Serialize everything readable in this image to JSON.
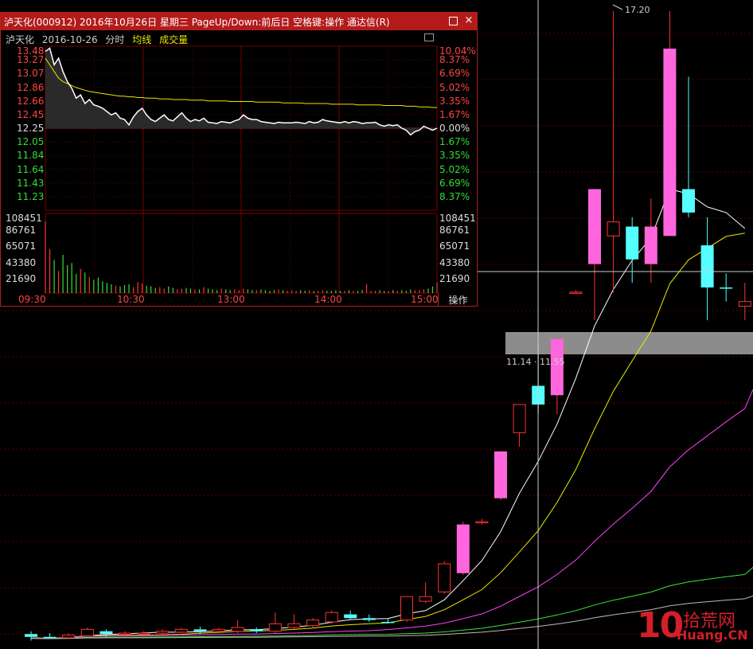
{
  "window": {
    "title": "泸天化(000912) 2016年10月26日 星期三 PageUp/Down:前后日 空格键:操作 通达信(R)",
    "close_glyph": "×"
  },
  "subheader": {
    "name": "泸天化",
    "date": "2016-10-26",
    "mode": "分时",
    "avg_label": "均线",
    "vol_label": "成交量"
  },
  "intraday": {
    "price_axis_left": [
      "13.48",
      "13.27",
      "13.07",
      "12.86",
      "12.66",
      "12.45",
      "12.25",
      "12.05",
      "11.84",
      "11.64",
      "11.43",
      "11.23"
    ],
    "pct_axis_right": [
      "10.04%",
      "8.37%",
      "6.69%",
      "5.02%",
      "3.35%",
      "1.67%",
      "0.00%",
      "1.67%",
      "3.35%",
      "5.02%",
      "6.69%",
      "8.37%"
    ],
    "vol_axis_left": [
      "108451",
      "86761",
      "65071",
      "43380",
      "21690"
    ],
    "vol_axis_right": [
      "108451",
      "86761",
      "65071",
      "43380",
      "21690"
    ],
    "time_labels": [
      "09:30",
      "10:30",
      "13:00",
      "14:00",
      "15:00"
    ],
    "operate_button": "操作",
    "prev_close": 12.25,
    "price_series": [
      13.4,
      13.45,
      13.2,
      13.3,
      13.1,
      12.95,
      12.85,
      12.7,
      12.75,
      12.62,
      12.68,
      12.6,
      12.58,
      12.55,
      12.5,
      12.45,
      12.48,
      12.4,
      12.38,
      12.3,
      12.42,
      12.5,
      12.55,
      12.45,
      12.38,
      12.35,
      12.4,
      12.45,
      12.38,
      12.36,
      12.42,
      12.48,
      12.4,
      12.35,
      12.38,
      12.36,
      12.4,
      12.34,
      12.33,
      12.32,
      12.35,
      12.34,
      12.33,
      12.36,
      12.38,
      12.45,
      12.4,
      12.38,
      12.38,
      12.35,
      12.34,
      12.33,
      12.32,
      12.34,
      12.33,
      12.33,
      12.33,
      12.34,
      12.33,
      12.32,
      12.35,
      12.33,
      12.34,
      12.38,
      12.36,
      12.35,
      12.34,
      12.33,
      12.35,
      12.33,
      12.35,
      12.34,
      12.32,
      12.33,
      12.33,
      12.34,
      12.3,
      12.28,
      12.3,
      12.29,
      12.3,
      12.25,
      12.22,
      12.15,
      12.2,
      12.22,
      12.28,
      12.25,
      12.22,
      12.25
    ],
    "avg_series": [
      13.3,
      13.2,
      13.1,
      13.0,
      12.95,
      12.92,
      12.89,
      12.86,
      12.84,
      12.82,
      12.8,
      12.79,
      12.78,
      12.77,
      12.76,
      12.75,
      12.74,
      12.73,
      12.73,
      12.72,
      12.72,
      12.71,
      12.71,
      12.7,
      12.7,
      12.7,
      12.69,
      12.69,
      12.69,
      12.68,
      12.68,
      12.68,
      12.68,
      12.67,
      12.67,
      12.67,
      12.67,
      12.66,
      12.66,
      12.66,
      12.66,
      12.66,
      12.65,
      12.65,
      12.65,
      12.65,
      12.65,
      12.65,
      12.64,
      12.64,
      12.64,
      12.64,
      12.64,
      12.64,
      12.63,
      12.63,
      12.63,
      12.63,
      12.63,
      12.62,
      12.62,
      12.62,
      12.62,
      12.62,
      12.62,
      12.61,
      12.61,
      12.61,
      12.61,
      12.61,
      12.61,
      12.6,
      12.6,
      12.6,
      12.6,
      12.6,
      12.6,
      12.59,
      12.59,
      12.59,
      12.59,
      12.59,
      12.58,
      12.58,
      12.58,
      12.57,
      12.57,
      12.57,
      12.56,
      12.56
    ],
    "volume_series": [
      98000,
      60000,
      45000,
      30000,
      52000,
      38000,
      41000,
      26000,
      33000,
      28000,
      22000,
      18000,
      21000,
      16000,
      14000,
      12000,
      10000,
      9000,
      11000,
      12000,
      8000,
      15000,
      13000,
      10000,
      9000,
      7000,
      8000,
      6000,
      9000,
      7000,
      5000,
      6000,
      7000,
      6000,
      5000,
      5000,
      8000,
      6000,
      5000,
      4000,
      6000,
      5000,
      4000,
      5000,
      4000,
      6000,
      5000,
      4000,
      4000,
      5000,
      4000,
      3000,
      4000,
      5000,
      4000,
      3000,
      4000,
      3000,
      4000,
      3000,
      4000,
      3000,
      3000,
      4000,
      3000,
      3000,
      4000,
      3000,
      3000,
      4000,
      3000,
      3000,
      4000,
      12000,
      3000,
      3000,
      4000,
      3000,
      3000,
      4000,
      3000,
      4000,
      3000,
      5000,
      4000,
      4000,
      5000,
      6000,
      9000,
      14000
    ]
  },
  "kline": {
    "price_label_top": "17.20",
    "crosshair_tip": "11.14 · 11.55",
    "candles": [
      {
        "o": 10.55,
        "h": 10.58,
        "l": 10.48,
        "c": 10.52,
        "up": false
      },
      {
        "o": 10.52,
        "h": 10.56,
        "l": 10.5,
        "c": 10.51,
        "up": false
      },
      {
        "o": 10.51,
        "h": 10.56,
        "l": 10.5,
        "c": 10.54,
        "up": true
      },
      {
        "o": 10.53,
        "h": 10.62,
        "l": 10.52,
        "c": 10.6,
        "up": true
      },
      {
        "o": 10.58,
        "h": 10.6,
        "l": 10.52,
        "c": 10.55,
        "up": false
      },
      {
        "o": 10.55,
        "h": 10.58,
        "l": 10.52,
        "c": 10.56,
        "up": true
      },
      {
        "o": 10.56,
        "h": 10.58,
        "l": 10.54,
        "c": 10.56,
        "up": true
      },
      {
        "o": 10.56,
        "h": 10.6,
        "l": 10.54,
        "c": 10.58,
        "up": true
      },
      {
        "o": 10.57,
        "h": 10.62,
        "l": 10.56,
        "c": 10.6,
        "up": true
      },
      {
        "o": 10.6,
        "h": 10.63,
        "l": 10.55,
        "c": 10.58,
        "up": false
      },
      {
        "o": 10.58,
        "h": 10.62,
        "l": 10.56,
        "c": 10.6,
        "up": true
      },
      {
        "o": 10.58,
        "h": 10.7,
        "l": 10.56,
        "c": 10.62,
        "up": true
      },
      {
        "o": 10.6,
        "h": 10.62,
        "l": 10.56,
        "c": 10.58,
        "up": false
      },
      {
        "o": 10.58,
        "h": 10.78,
        "l": 10.56,
        "c": 10.66,
        "up": true
      },
      {
        "o": 10.62,
        "h": 10.76,
        "l": 10.6,
        "c": 10.66,
        "up": true
      },
      {
        "o": 10.64,
        "h": 10.72,
        "l": 10.62,
        "c": 10.7,
        "up": true
      },
      {
        "o": 10.68,
        "h": 10.8,
        "l": 10.66,
        "c": 10.78,
        "up": true
      },
      {
        "o": 10.76,
        "h": 10.8,
        "l": 10.7,
        "c": 10.72,
        "up": false
      },
      {
        "o": 10.72,
        "h": 10.76,
        "l": 10.68,
        "c": 10.7,
        "up": false
      },
      {
        "o": 10.68,
        "h": 10.72,
        "l": 10.66,
        "c": 10.68,
        "up": false
      },
      {
        "o": 10.7,
        "h": 10.95,
        "l": 10.68,
        "c": 10.95,
        "up": true
      },
      {
        "o": 10.9,
        "h": 11.1,
        "l": 10.88,
        "c": 10.95,
        "up": true
      },
      {
        "o": 11.0,
        "h": 11.33,
        "l": 10.98,
        "c": 11.3,
        "up": true
      },
      {
        "o": 11.2,
        "h": 11.75,
        "l": 11.18,
        "c": 11.72,
        "up": true
      },
      {
        "o": 11.75,
        "h": 11.78,
        "l": 11.72,
        "c": 11.75,
        "up": true
      },
      {
        "o": 12.0,
        "h": 12.5,
        "l": 11.98,
        "c": 12.5,
        "up": true
      },
      {
        "o": 12.7,
        "h": 13.0,
        "l": 12.55,
        "c": 13.0,
        "up": true
      },
      {
        "o": 13.2,
        "h": 13.62,
        "l": 12.9,
        "c": 13.0,
        "up": false
      },
      {
        "o": 13.1,
        "h": 13.7,
        "l": 12.9,
        "c": 13.7,
        "up": true
      },
      {
        "o": 14.2,
        "h": 14.22,
        "l": 14.18,
        "c": 14.2,
        "up": true
      },
      {
        "o": 14.5,
        "h": 15.3,
        "l": 13.9,
        "c": 15.3,
        "up": true
      },
      {
        "o": 14.8,
        "h": 17.2,
        "l": 14.2,
        "c": 14.95,
        "up": true
      },
      {
        "o": 14.9,
        "h": 15.0,
        "l": 14.3,
        "c": 14.55,
        "up": false
      },
      {
        "o": 14.5,
        "h": 15.2,
        "l": 14.3,
        "c": 14.9,
        "up": true
      },
      {
        "o": 14.8,
        "h": 17.2,
        "l": 14.8,
        "c": 16.8,
        "up": true
      },
      {
        "o": 15.3,
        "h": 16.5,
        "l": 15.0,
        "c": 15.05,
        "up": false
      },
      {
        "o": 14.7,
        "h": 15.0,
        "l": 13.9,
        "c": 14.25,
        "up": false
      },
      {
        "o": 14.25,
        "h": 14.4,
        "l": 14.1,
        "c": 14.25,
        "up": false
      },
      {
        "o": 14.1,
        "h": 14.3,
        "l": 13.9,
        "c": 14.05,
        "up": true
      }
    ]
  }
}
